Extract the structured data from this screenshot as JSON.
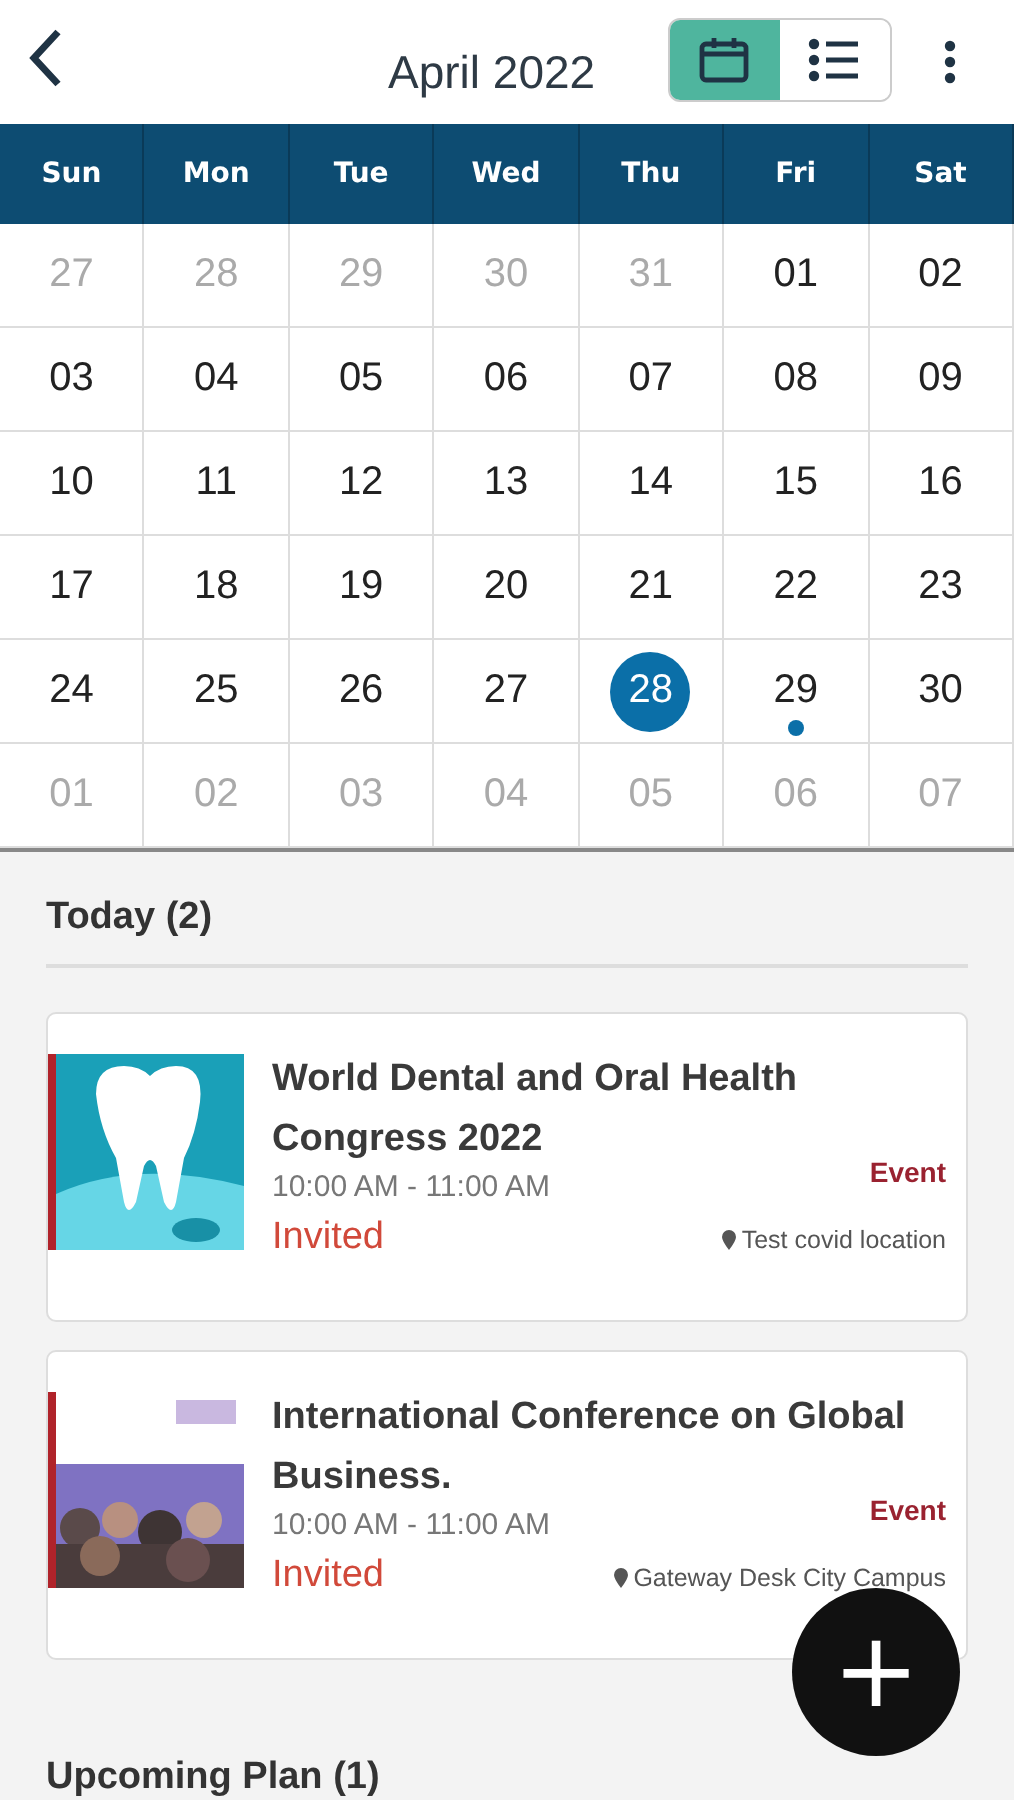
{
  "header": {
    "title": "April 2022",
    "views": [
      {
        "kind": "calendar",
        "selected": true
      },
      {
        "kind": "list",
        "selected": false
      }
    ]
  },
  "weekdays": [
    "Sun",
    "Mon",
    "Tue",
    "Wed",
    "Thu",
    "Fri",
    "Sat"
  ],
  "days": [
    {
      "label": "27",
      "muted": true,
      "selected": false,
      "has_event": false
    },
    {
      "label": "28",
      "muted": true,
      "selected": false,
      "has_event": false
    },
    {
      "label": "29",
      "muted": true,
      "selected": false,
      "has_event": false
    },
    {
      "label": "30",
      "muted": true,
      "selected": false,
      "has_event": false
    },
    {
      "label": "31",
      "muted": true,
      "selected": false,
      "has_event": false
    },
    {
      "label": "01",
      "muted": false,
      "selected": false,
      "has_event": false
    },
    {
      "label": "02",
      "muted": false,
      "selected": false,
      "has_event": false
    },
    {
      "label": "03",
      "muted": false,
      "selected": false,
      "has_event": false
    },
    {
      "label": "04",
      "muted": false,
      "selected": false,
      "has_event": false
    },
    {
      "label": "05",
      "muted": false,
      "selected": false,
      "has_event": false
    },
    {
      "label": "06",
      "muted": false,
      "selected": false,
      "has_event": false
    },
    {
      "label": "07",
      "muted": false,
      "selected": false,
      "has_event": false
    },
    {
      "label": "08",
      "muted": false,
      "selected": false,
      "has_event": false
    },
    {
      "label": "09",
      "muted": false,
      "selected": false,
      "has_event": false
    },
    {
      "label": "10",
      "muted": false,
      "selected": false,
      "has_event": false
    },
    {
      "label": "11",
      "muted": false,
      "selected": false,
      "has_event": false
    },
    {
      "label": "12",
      "muted": false,
      "selected": false,
      "has_event": false
    },
    {
      "label": "13",
      "muted": false,
      "selected": false,
      "has_event": false
    },
    {
      "label": "14",
      "muted": false,
      "selected": false,
      "has_event": false
    },
    {
      "label": "15",
      "muted": false,
      "selected": false,
      "has_event": false
    },
    {
      "label": "16",
      "muted": false,
      "selected": false,
      "has_event": false
    },
    {
      "label": "17",
      "muted": false,
      "selected": false,
      "has_event": false
    },
    {
      "label": "18",
      "muted": false,
      "selected": false,
      "has_event": false
    },
    {
      "label": "19",
      "muted": false,
      "selected": false,
      "has_event": false
    },
    {
      "label": "20",
      "muted": false,
      "selected": false,
      "has_event": false
    },
    {
      "label": "21",
      "muted": false,
      "selected": false,
      "has_event": false
    },
    {
      "label": "22",
      "muted": false,
      "selected": false,
      "has_event": false
    },
    {
      "label": "23",
      "muted": false,
      "selected": false,
      "has_event": false
    },
    {
      "label": "24",
      "muted": false,
      "selected": false,
      "has_event": false
    },
    {
      "label": "25",
      "muted": false,
      "selected": false,
      "has_event": false
    },
    {
      "label": "26",
      "muted": false,
      "selected": false,
      "has_event": false
    },
    {
      "label": "27",
      "muted": false,
      "selected": false,
      "has_event": false
    },
    {
      "label": "28",
      "muted": false,
      "selected": true,
      "has_event": false
    },
    {
      "label": "29",
      "muted": false,
      "selected": false,
      "has_event": true
    },
    {
      "label": "30",
      "muted": false,
      "selected": false,
      "has_event": false
    },
    {
      "label": "01",
      "muted": true,
      "selected": false,
      "has_event": false
    },
    {
      "label": "02",
      "muted": true,
      "selected": false,
      "has_event": false
    },
    {
      "label": "03",
      "muted": true,
      "selected": false,
      "has_event": false
    },
    {
      "label": "04",
      "muted": true,
      "selected": false,
      "has_event": false
    },
    {
      "label": "05",
      "muted": true,
      "selected": false,
      "has_event": false
    },
    {
      "label": "06",
      "muted": true,
      "selected": false,
      "has_event": false
    },
    {
      "label": "07",
      "muted": true,
      "selected": false,
      "has_event": false
    }
  ],
  "today_heading": "Today (2)",
  "events": [
    {
      "title": "World Dental and Oral Health Congress 2022",
      "time": "10:00 AM - 11:00 AM",
      "status": "Invited",
      "type": "Event",
      "location": "Test covid location"
    },
    {
      "title": "International Conference on Global Business.",
      "time": "10:00 AM - 11:00 AM",
      "status": "Invited",
      "type": "Event",
      "location": "Gateway Desk City Campus"
    }
  ],
  "upcoming_heading": "Upcoming Plan (1)",
  "fab": "+"
}
